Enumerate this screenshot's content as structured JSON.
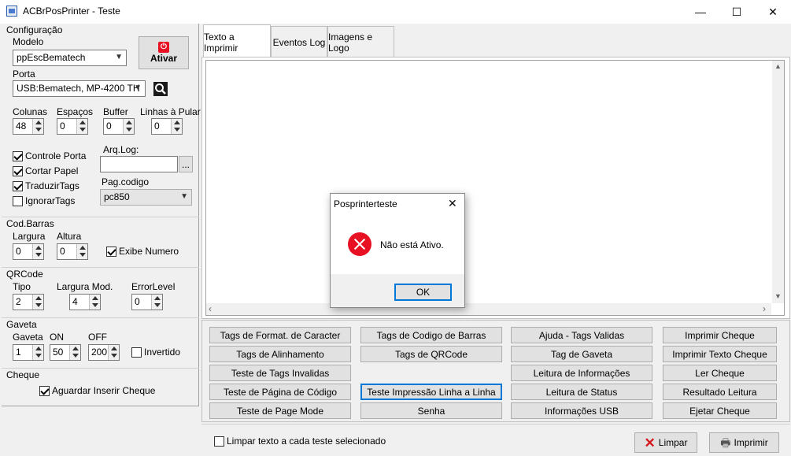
{
  "window": {
    "title": "ACBrPosPrinter - Teste",
    "minimize": "—",
    "maximize": "☐",
    "close": "✕"
  },
  "config": {
    "section": "Configuração",
    "modelo_label": "Modelo",
    "modelo_value": "ppEscBematech",
    "ativar": "Ativar",
    "porta_label": "Porta",
    "porta_value": "USB:Bematech, MP-4200 TH",
    "colunas_label": "Colunas",
    "colunas": "48",
    "espacos_label": "Espaços",
    "espacos": "0",
    "buffer_label": "Buffer",
    "buffer": "0",
    "linhas_label": "Linhas à Pular",
    "linhas": "0",
    "controle_porta": "Controle Porta",
    "cortar_papel": "Cortar Papel",
    "traduzir_tags": "TraduzirTags",
    "ignorar_tags": "IgnorarTags",
    "arqlog_label": "Arq.Log:",
    "arqlog_value": "",
    "browse": "...",
    "pagcodigo_label": "Pag.codigo",
    "pagcodigo_value": "pc850"
  },
  "codbarras": {
    "section": "Cod.Barras",
    "largura_label": "Largura",
    "largura": "0",
    "altura_label": "Altura",
    "altura": "0",
    "exibe_numero": "Exibe Numero"
  },
  "qrcode": {
    "section": "QRCode",
    "tipo_label": "Tipo",
    "tipo": "2",
    "largura_label": "Largura Mod.",
    "largura": "4",
    "error_label": "ErrorLevel",
    "error": "0"
  },
  "gaveta": {
    "section": "Gaveta",
    "gaveta_label": "Gaveta",
    "gaveta": "1",
    "on_label": "ON",
    "on": "50",
    "off_label": "OFF",
    "off": "200",
    "invertido": "Invertido"
  },
  "cheque": {
    "section": "Cheque",
    "aguardar": "Aguardar Inserir Cheque"
  },
  "tabs": [
    "Texto a Imprimir",
    "Eventos Log",
    "Imagens e Logo"
  ],
  "buttons": {
    "col1": [
      "Tags de Format. de Caracter",
      "Tags de Alinhamento",
      "Teste de Tags Invalidas",
      "Teste de Página de Código",
      "Teste de Page Mode"
    ],
    "col2": [
      "Tags de Codigo de Barras",
      "Tags de QRCode",
      "Teste Impressão Linha a Linha",
      "Senha"
    ],
    "col3": [
      "Ajuda - Tags Validas",
      "Tag de Gaveta",
      "Leitura de Informações",
      "Leitura de Status",
      "Informações USB"
    ],
    "col4": [
      "Imprimir Cheque",
      "Imprimir Texto Cheque",
      "Ler Cheque",
      "Resultado Leitura",
      "Ejetar Cheque"
    ]
  },
  "bottom": {
    "limpar_check": "Limpar texto a cada teste selecionado",
    "limpar": "Limpar",
    "imprimir": "Imprimir"
  },
  "dialog": {
    "title": "Posprinterteste",
    "message": "Não está Ativo.",
    "ok": "OK",
    "close": "✕"
  },
  "colors": {
    "accent": "#0078d7",
    "error": "#e81123",
    "button": "#e1e1e1"
  }
}
